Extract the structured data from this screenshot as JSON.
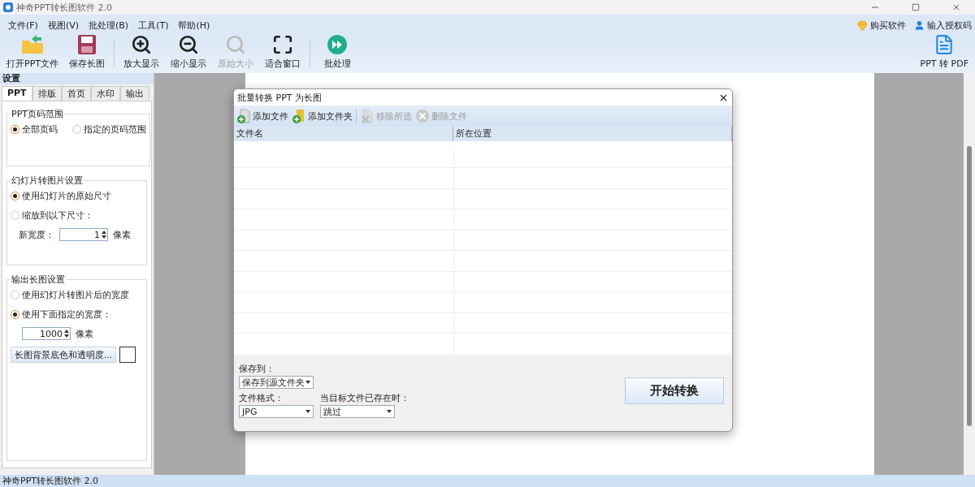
{
  "window": {
    "title": "神奇PPT转长图软件 2.0"
  },
  "menu": [
    {
      "label": "文件(F)"
    },
    {
      "label": "视图(V)"
    },
    {
      "label": "批处理(B)"
    },
    {
      "label": "工具(T)"
    },
    {
      "label": "帮助(H)"
    }
  ],
  "account_links": [
    {
      "kind": "buy",
      "label": "购买软件"
    },
    {
      "kind": "user",
      "label": "输入授权码"
    }
  ],
  "toolbar": [
    {
      "kind": "open",
      "label": "打开PPT文件",
      "disabled": false
    },
    {
      "kind": "save",
      "label": "保存长图",
      "disabled": false
    },
    {
      "kind": "separator"
    },
    {
      "kind": "zoom_in",
      "label": "放大显示",
      "disabled": false
    },
    {
      "kind": "zoom_out",
      "label": "缩小显示",
      "disabled": false
    },
    {
      "kind": "actual",
      "label": "原始大小",
      "disabled": true
    },
    {
      "kind": "fit",
      "label": "适合窗口",
      "disabled": false
    },
    {
      "kind": "separator"
    },
    {
      "kind": "batch",
      "label": "批处理",
      "disabled": false
    }
  ],
  "toolbar_right": {
    "kind": "pdf",
    "label": "PPT 转 PDF"
  },
  "settings": {
    "title": "设置",
    "tabs": [
      {
        "label": "PPT",
        "selected": true
      },
      {
        "label": "排版",
        "selected": false
      },
      {
        "label": "首页",
        "selected": false
      },
      {
        "label": "水印",
        "selected": false
      },
      {
        "label": "输出",
        "selected": false
      }
    ],
    "groups": [
      {
        "title": "PPT页码范围",
        "kind": "inline",
        "options": [
          {
            "label": "全部页码",
            "selected": true
          },
          {
            "label": "指定的页码范围",
            "selected": false
          }
        ]
      },
      {
        "title": "幻灯片转图片设置",
        "kind": "stacked",
        "options": [
          {
            "label": "使用幻灯片的原始尺寸",
            "selected": true
          },
          {
            "label": "缩放到以下尺寸：",
            "selected": false
          }
        ],
        "spin": {
          "label": "新宽度：",
          "value": "1",
          "unit": "像素"
        }
      },
      {
        "title": "输出长图设置",
        "kind": "stacked",
        "options": [
          {
            "label": "使用幻灯片转图片后的宽度",
            "selected": false
          },
          {
            "label": "使用下面指定的宽度：",
            "selected": true
          }
        ],
        "spin": {
          "value": "1000",
          "unit": "像素"
        },
        "color_button": {
          "label": "长图背景底色和透明度..."
        }
      }
    ]
  },
  "dialog": {
    "title": "批量转换 PPT 为长图",
    "toolbar": [
      {
        "kind": "add_file",
        "label": "添加文件",
        "disabled": false
      },
      {
        "kind": "add_folder",
        "label": "添加文件夹",
        "disabled": false
      },
      {
        "kind": "separator"
      },
      {
        "kind": "remove",
        "label": "移除所选",
        "disabled": true
      },
      {
        "kind": "delete",
        "label": "删除文件",
        "disabled": true
      }
    ],
    "columns": [
      "文件名",
      "所在位置"
    ],
    "save_to": {
      "label": "保存到：",
      "value": "保存到源文件夹"
    },
    "format": {
      "label": "文件格式：",
      "value": "JPG"
    },
    "when_exists": {
      "label": "当目标文件已存在时：",
      "value": "跳过"
    },
    "start_button": "开始转换"
  },
  "status_bar": "神奇PPT转长图软件 2.0"
}
